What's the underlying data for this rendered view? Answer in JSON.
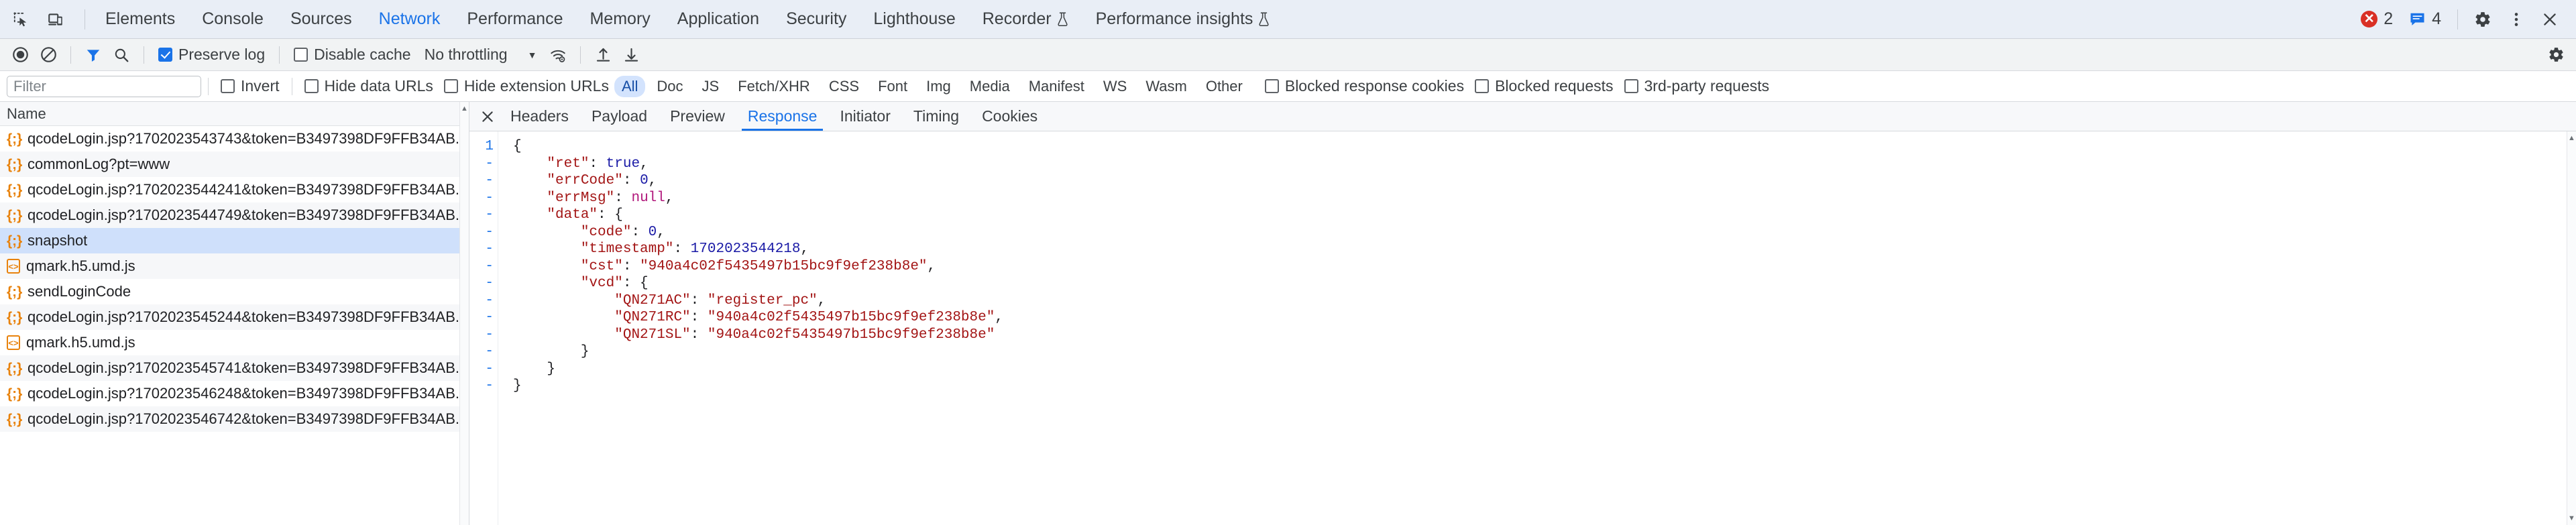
{
  "tabbar": {
    "icons": [
      {
        "name": "inspect-element-icon",
        "title": "Inspect element"
      },
      {
        "name": "device-toolbar-icon",
        "title": "Toggle device toolbar"
      }
    ],
    "tabs": [
      {
        "label": "Elements",
        "active": false,
        "experiment": false
      },
      {
        "label": "Console",
        "active": false,
        "experiment": false
      },
      {
        "label": "Sources",
        "active": false,
        "experiment": false
      },
      {
        "label": "Network",
        "active": true,
        "experiment": false
      },
      {
        "label": "Performance",
        "active": false,
        "experiment": false
      },
      {
        "label": "Memory",
        "active": false,
        "experiment": false
      },
      {
        "label": "Application",
        "active": false,
        "experiment": false
      },
      {
        "label": "Security",
        "active": false,
        "experiment": false
      },
      {
        "label": "Lighthouse",
        "active": false,
        "experiment": false
      },
      {
        "label": "Recorder",
        "active": false,
        "experiment": true
      },
      {
        "label": "Performance insights",
        "active": false,
        "experiment": true
      }
    ],
    "error_count": "2",
    "message_count": "4",
    "settings_label": "Settings",
    "more_label": "Customize and control DevTools",
    "close_label": "Close DevTools"
  },
  "toolbar": {
    "record_title": "Stop recording network log",
    "clear_title": "Clear network log",
    "filter_title": "Filter",
    "search_title": "Search",
    "preserve_log_label": "Preserve log",
    "preserve_log_checked": true,
    "disable_cache_label": "Disable cache",
    "disable_cache_checked": false,
    "throttling_value": "No throttling",
    "network_conditions_title": "Network conditions",
    "import_title": "Import HAR file",
    "export_title": "Export HAR file",
    "settings_title": "Network settings"
  },
  "filterbar": {
    "filter_placeholder": "Filter",
    "filter_value": "",
    "invert_label": "Invert",
    "invert_checked": false,
    "hide_data_urls_label": "Hide data URLs",
    "hide_data_urls_checked": false,
    "hide_extension_urls_label": "Hide extension URLs",
    "hide_extension_urls_checked": false,
    "type_pills": [
      {
        "label": "All",
        "active": true
      },
      {
        "label": "Doc",
        "active": false
      },
      {
        "label": "JS",
        "active": false
      },
      {
        "label": "Fetch/XHR",
        "active": false
      },
      {
        "label": "CSS",
        "active": false
      },
      {
        "label": "Font",
        "active": false
      },
      {
        "label": "Img",
        "active": false
      },
      {
        "label": "Media",
        "active": false
      },
      {
        "label": "Manifest",
        "active": false
      },
      {
        "label": "WS",
        "active": false
      },
      {
        "label": "Wasm",
        "active": false
      },
      {
        "label": "Other",
        "active": false
      }
    ],
    "blocked_response_cookies_label": "Blocked response cookies",
    "blocked_response_cookies_checked": false,
    "blocked_requests_label": "Blocked requests",
    "blocked_requests_checked": false,
    "third_party_requests_label": "3rd-party requests",
    "third_party_requests_checked": false
  },
  "requests": {
    "column_header": "Name",
    "rows": [
      {
        "name": "qcodeLogin.jsp?1702023543743&token=B3497398DF9FFB34AB...",
        "icon": "json-icon",
        "selected": false
      },
      {
        "name": "commonLog?pt=www",
        "icon": "json-icon",
        "selected": false
      },
      {
        "name": "qcodeLogin.jsp?1702023544241&token=B3497398DF9FFB34AB...",
        "icon": "json-icon",
        "selected": false
      },
      {
        "name": "qcodeLogin.jsp?1702023544749&token=B3497398DF9FFB34AB...",
        "icon": "json-icon",
        "selected": false
      },
      {
        "name": "snapshot",
        "icon": "json-icon",
        "selected": true
      },
      {
        "name": "qmark.h5.umd.js",
        "icon": "js-icon",
        "selected": false
      },
      {
        "name": "sendLoginCode",
        "icon": "json-icon",
        "selected": false
      },
      {
        "name": "qcodeLogin.jsp?1702023545244&token=B3497398DF9FFB34AB...",
        "icon": "json-icon",
        "selected": false
      },
      {
        "name": "qmark.h5.umd.js",
        "icon": "js-icon",
        "selected": false
      },
      {
        "name": "qcodeLogin.jsp?1702023545741&token=B3497398DF9FFB34AB...",
        "icon": "json-icon",
        "selected": false
      },
      {
        "name": "qcodeLogin.jsp?1702023546248&token=B3497398DF9FFB34AB...",
        "icon": "json-icon",
        "selected": false
      },
      {
        "name": "qcodeLogin.jsp?1702023546742&token=B3497398DF9FFB34AB...",
        "icon": "json-icon",
        "selected": false
      }
    ]
  },
  "detail": {
    "close_label": "✕",
    "tabs": [
      {
        "label": "Headers",
        "active": false
      },
      {
        "label": "Payload",
        "active": false
      },
      {
        "label": "Preview",
        "active": false
      },
      {
        "label": "Response",
        "active": true
      },
      {
        "label": "Initiator",
        "active": false
      },
      {
        "label": "Timing",
        "active": false
      },
      {
        "label": "Cookies",
        "active": false
      }
    ],
    "gutter": [
      "1",
      "-",
      "-",
      "-",
      "-",
      "-",
      "-",
      "-",
      "-",
      "-",
      "-",
      "-",
      "-",
      "-",
      "-"
    ],
    "response_json": {
      "ret": true,
      "errCode": 0,
      "errMsg": null,
      "data": {
        "code": 0,
        "timestamp": 1702023544218,
        "cst": "940a4c02f5435497b15bc9f9ef238b8e",
        "vcd": {
          "QN271AC": "register_pc",
          "QN271RC": "940a4c02f5435497b15bc9f9ef238b8e",
          "QN271SL": "940a4c02f5435497b15bc9f9ef238b8e"
        }
      }
    }
  },
  "colors": {
    "accent": "#1a73e8",
    "error": "#d93025",
    "selection": "#cfe0fb",
    "icon_orange": "#e8820c",
    "json_string": "#a31515",
    "json_number": "#1a1aa6",
    "json_null": "#b1177b"
  }
}
